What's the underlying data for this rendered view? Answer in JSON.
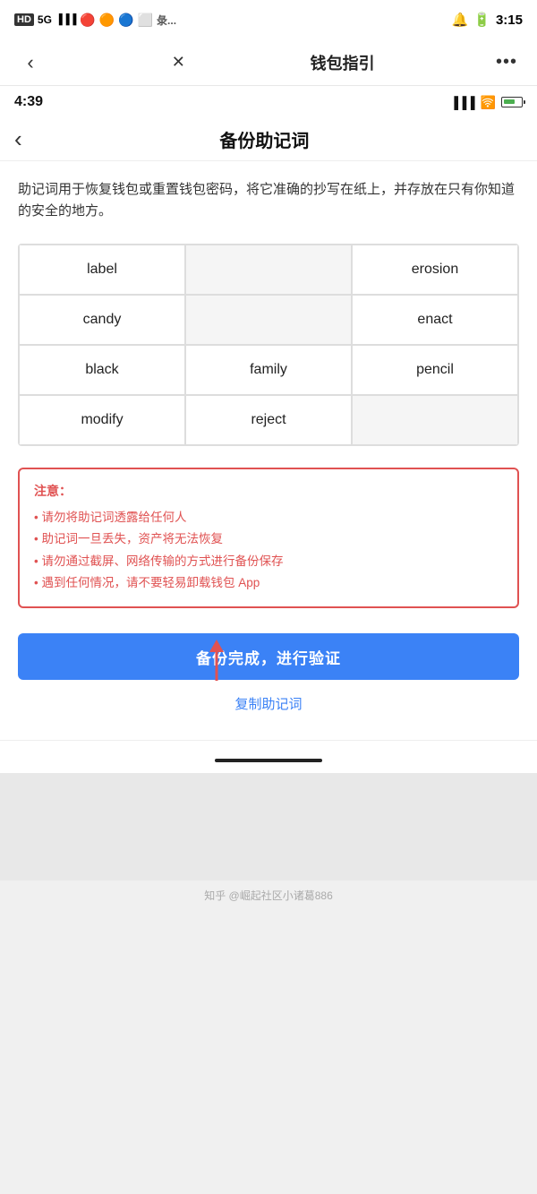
{
  "outerStatusBar": {
    "leftIcons": "HD 5G",
    "time": "3:15"
  },
  "appBar": {
    "backLabel": "‹",
    "closeLabel": "✕",
    "title": "钱包指引",
    "moreLabel": "···"
  },
  "innerStatusBar": {
    "time": "4:39"
  },
  "innerNavBar": {
    "backLabel": "‹",
    "title": "备份助记词"
  },
  "description": "助记词用于恢复钱包或重置钱包密码，将它准确的抄写在纸上，并存放在只有你知道的安全的地方。",
  "mnemonicWords": [
    {
      "word": "label",
      "position": 1,
      "empty": false
    },
    {
      "word": "",
      "position": 2,
      "empty": true
    },
    {
      "word": "erosion",
      "position": 3,
      "empty": false
    },
    {
      "word": "candy",
      "position": 4,
      "empty": false
    },
    {
      "word": "",
      "position": 5,
      "empty": true
    },
    {
      "word": "enact",
      "position": 6,
      "empty": false
    },
    {
      "word": "black",
      "position": 7,
      "empty": false
    },
    {
      "word": "family",
      "position": 8,
      "empty": false
    },
    {
      "word": "pencil",
      "position": 9,
      "empty": false
    },
    {
      "word": "modify",
      "position": 10,
      "empty": false
    },
    {
      "word": "reject",
      "position": 11,
      "empty": false
    },
    {
      "word": "",
      "position": 12,
      "empty": true
    }
  ],
  "warning": {
    "title": "注意：",
    "items": [
      "• 请勿将助记词透露给任何人",
      "• 助记词一旦丢失，资产将无法恢复",
      "• 请勿通过截屏、网络传输的方式进行备份保存",
      "• 遇到任何情况，请不要轻易卸载钱包 App"
    ]
  },
  "confirmButton": {
    "label": "备份完成，进行验证"
  },
  "copyLink": {
    "label": "复制助记词"
  },
  "watermark": {
    "text": "知乎 @崛起社区小诸葛886"
  }
}
